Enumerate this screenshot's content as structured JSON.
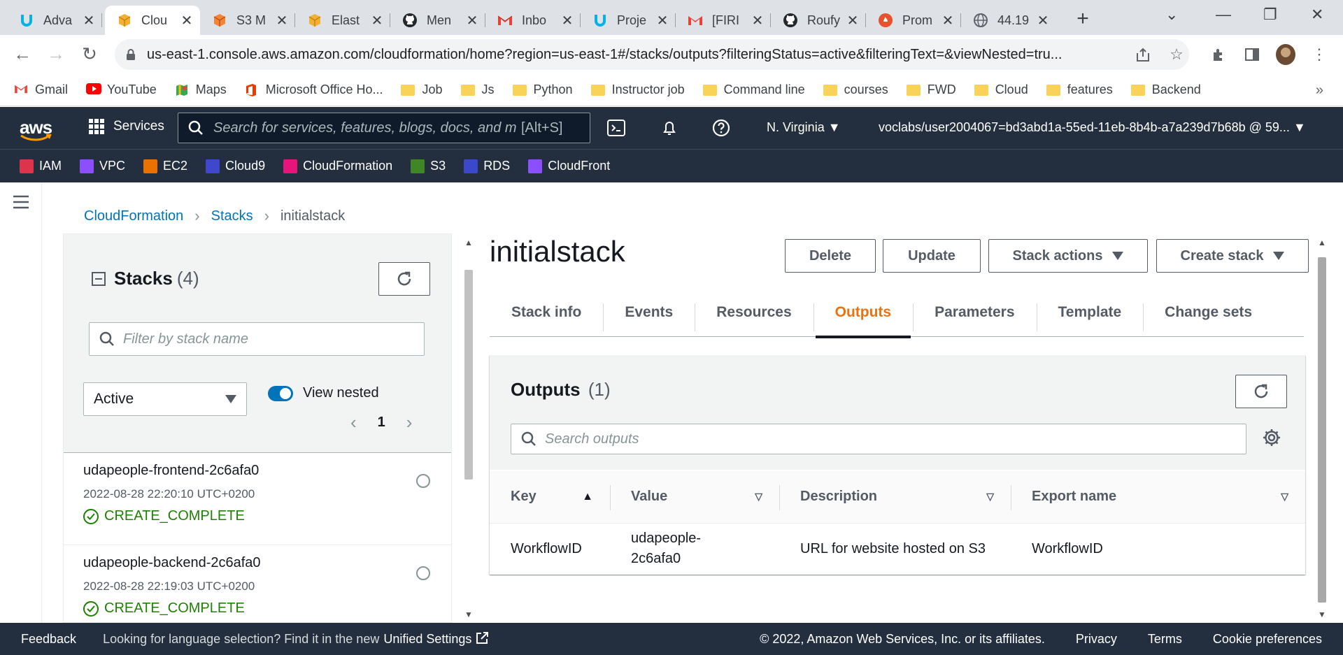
{
  "browser": {
    "tabs": [
      {
        "label": "Adva",
        "icon": "udacity-icon",
        "active": false
      },
      {
        "label": "Clou",
        "icon": "aws-cube-icon",
        "active": true
      },
      {
        "label": "S3 M",
        "icon": "aws-cube-orange-icon",
        "active": false
      },
      {
        "label": "Elast",
        "icon": "aws-cube-icon",
        "active": false
      },
      {
        "label": "Men",
        "icon": "github-icon",
        "active": false
      },
      {
        "label": "Inbo",
        "icon": "gmail-icon",
        "active": false
      },
      {
        "label": "Proje",
        "icon": "udacity-icon",
        "active": false
      },
      {
        "label": "[FIRI",
        "icon": "gmail-icon",
        "active": false
      },
      {
        "label": "Roufy",
        "icon": "github-icon",
        "active": false
      },
      {
        "label": "Prom",
        "icon": "prometheus-icon",
        "active": false
      },
      {
        "label": "44.19",
        "icon": "globe-icon",
        "active": false
      }
    ],
    "url": "us-east-1.console.aws.amazon.com/cloudformation/home?region=us-east-1#/stacks/outputs?filteringStatus=active&filteringText=&viewNested=tru..."
  },
  "bookmarks": [
    {
      "label": "Gmail",
      "icon": "gmail-icon"
    },
    {
      "label": "YouTube",
      "icon": "youtube-icon"
    },
    {
      "label": "Maps",
      "icon": "maps-icon"
    },
    {
      "label": "Microsoft Office Ho...",
      "icon": "office-icon"
    },
    {
      "label": "Job",
      "icon": "folder-icon"
    },
    {
      "label": "Js",
      "icon": "folder-icon"
    },
    {
      "label": "Python",
      "icon": "folder-icon"
    },
    {
      "label": "Instructor job",
      "icon": "folder-icon"
    },
    {
      "label": "Command line",
      "icon": "folder-icon"
    },
    {
      "label": "courses",
      "icon": "folder-icon"
    },
    {
      "label": "FWD",
      "icon": "folder-icon"
    },
    {
      "label": "Cloud",
      "icon": "folder-icon"
    },
    {
      "label": "features",
      "icon": "folder-icon"
    },
    {
      "label": "Backend",
      "icon": "folder-icon"
    }
  ],
  "aws": {
    "logo": "aws",
    "services_label": "Services",
    "search_placeholder": "Search for services, features, blogs, docs, and m",
    "search_shortcut": "[Alt+S]",
    "region": "N. Virginia",
    "account": "voclabs/user2004067=bd3abd1a-55ed-11eb-8b4b-a7a239d7b68b @ 59...",
    "favorites": [
      {
        "label": "IAM",
        "color": "#dd344c"
      },
      {
        "label": "VPC",
        "color": "#8c4fff"
      },
      {
        "label": "EC2",
        "color": "#ed7100"
      },
      {
        "label": "Cloud9",
        "color": "#3f48cc"
      },
      {
        "label": "CloudFormation",
        "color": "#e7157b"
      },
      {
        "label": "S3",
        "color": "#3f8624"
      },
      {
        "label": "RDS",
        "color": "#3b48cc"
      },
      {
        "label": "CloudFront",
        "color": "#8c4fff"
      }
    ]
  },
  "breadcrumb": {
    "root": "CloudFormation",
    "middle": "Stacks",
    "current": "initialstack"
  },
  "stacks_panel": {
    "title": "Stacks",
    "count": "(4)",
    "filter_placeholder": "Filter by stack name",
    "status_select": "Active",
    "view_nested_label": "View nested",
    "page": "1",
    "items": [
      {
        "name": "udapeople-frontend-2c6afa0",
        "date": "2022-08-28 22:20:10 UTC+0200",
        "status": "CREATE_COMPLETE"
      },
      {
        "name": "udapeople-backend-2c6afa0",
        "date": "2022-08-28 22:19:03 UTC+0200",
        "status": "CREATE_COMPLETE"
      }
    ]
  },
  "stack": {
    "title": "initialstack",
    "buttons": {
      "delete": "Delete",
      "update": "Update",
      "stack_actions": "Stack actions",
      "create_stack": "Create stack"
    },
    "tabs": [
      "Stack info",
      "Events",
      "Resources",
      "Outputs",
      "Parameters",
      "Template",
      "Change sets"
    ],
    "active_tab": "Outputs"
  },
  "outputs": {
    "title": "Outputs",
    "count": "(1)",
    "search_placeholder": "Search outputs",
    "columns": {
      "key": "Key",
      "value": "Value",
      "description": "Description",
      "export": "Export name"
    },
    "rows": [
      {
        "key": "WorkflowID",
        "value": "udapeople-2c6afa0",
        "description": "URL for website hosted on S3",
        "export": "WorkflowID"
      }
    ]
  },
  "footer": {
    "feedback": "Feedback",
    "language_text": "Looking for language selection? Find it in the new",
    "unified_settings": "Unified Settings",
    "copyright": "© 2022, Amazon Web Services, Inc. or its affiliates.",
    "privacy": "Privacy",
    "terms": "Terms",
    "cookies": "Cookie preferences"
  }
}
